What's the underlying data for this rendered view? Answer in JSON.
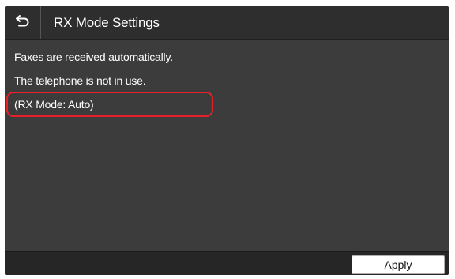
{
  "header": {
    "back_icon": "back-arrow-icon",
    "title": "RX Mode Settings"
  },
  "content": {
    "lines": [
      "Faxes are received automatically.",
      "The telephone is not in use.",
      "(RX Mode: Auto)"
    ],
    "highlight_color": "#e8202a"
  },
  "footer": {
    "apply_label": "Apply"
  }
}
